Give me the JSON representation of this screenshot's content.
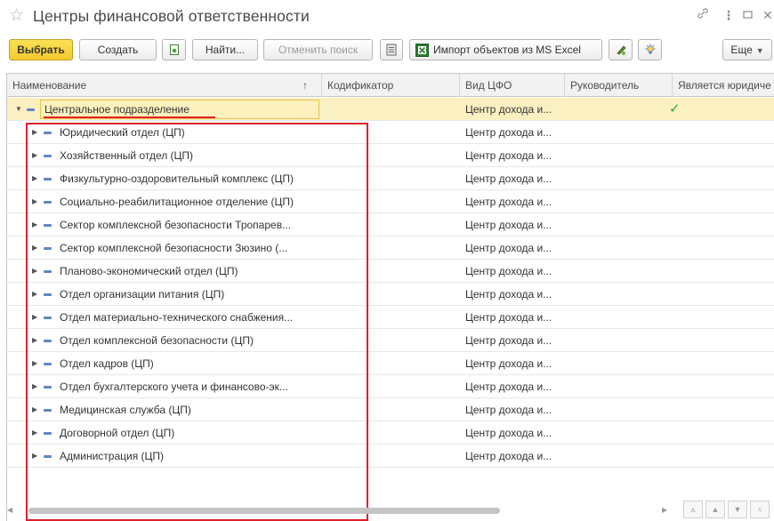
{
  "window": {
    "title": "Центры финансовой ответственности"
  },
  "toolbar": {
    "select_label": "Выбрать",
    "create_label": "Создать",
    "find_label": "Найти...",
    "cancel_search_label": "Отменить поиск",
    "import_label": "Импорт объектов из MS Excel",
    "more_label": "Еще"
  },
  "table": {
    "columns": [
      "Наименование",
      "Кодификатор",
      "Вид ЦФО",
      "Руководитель",
      "Является юридиче"
    ],
    "sort_indicator": "↑",
    "root": {
      "name": "Центральное подразделение",
      "type": "Центр дохода и...",
      "is_legal_entity": true
    },
    "rows": [
      {
        "name": "Юридический отдел (ЦП)",
        "type": "Центр дохода и..."
      },
      {
        "name": "Хозяйственный отдел (ЦП)",
        "type": "Центр дохода и..."
      },
      {
        "name": "Физкультурно-оздоровительный комплекс (ЦП)",
        "type": "Центр дохода и..."
      },
      {
        "name": "Социально-реабилитационное отделение (ЦП)",
        "type": "Центр дохода и..."
      },
      {
        "name": "Сектор комплексной безопасности Тропарев...",
        "type": "Центр дохода и..."
      },
      {
        "name": "Сектор комплексной безопасности Зюзино (...",
        "type": "Центр дохода и..."
      },
      {
        "name": "Планово-экономический отдел (ЦП)",
        "type": "Центр дохода и..."
      },
      {
        "name": "Отдел организации питания (ЦП)",
        "type": "Центр дохода и..."
      },
      {
        "name": "Отдел материально-технического снабжения...",
        "type": "Центр дохода и..."
      },
      {
        "name": "Отдел комплексной безопасности (ЦП)",
        "type": "Центр дохода и..."
      },
      {
        "name": "Отдел кадров (ЦП)",
        "type": "Центр дохода и..."
      },
      {
        "name": "Отдел бухгалтерского учета и финансово-эк...",
        "type": "Центр дохода и..."
      },
      {
        "name": "Медицинская служба (ЦП)",
        "type": "Центр дохода и..."
      },
      {
        "name": "Договорной отдел (ЦП)",
        "type": "Центр дохода и..."
      },
      {
        "name": "Администрация (ЦП)",
        "type": "Центр дохода и..."
      }
    ]
  },
  "colors": {
    "selected_row": "#fbf0c2",
    "primary_button": "#f4c92d",
    "highlight_box": "#e0202a",
    "check": "#28a745"
  },
  "icons": [
    "star-icon",
    "link-icon",
    "menu-icon",
    "maximize-icon",
    "close-icon",
    "document-icon",
    "list-icon",
    "excel-icon",
    "pen-icon",
    "bulb-icon",
    "expand-icon",
    "collapse-icon",
    "check-icon"
  ]
}
